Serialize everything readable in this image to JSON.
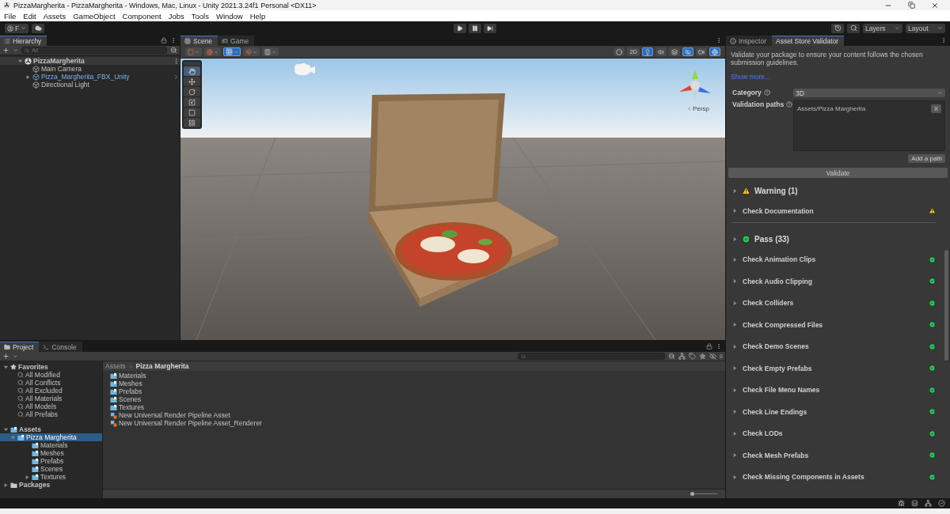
{
  "window": {
    "title": "PizzaMargherita - PizzaMargherita - Windows, Mac, Linux - Unity 2021.3.24f1 Personal <DX11>"
  },
  "menu": [
    "File",
    "Edit",
    "Assets",
    "GameObject",
    "Component",
    "Jobs",
    "Tools",
    "Window",
    "Help"
  ],
  "toolbar": {
    "account": "F",
    "layers": "Layers",
    "layout": "Layout"
  },
  "hierarchy": {
    "title": "Hierarchy",
    "search": {
      "placeholder": "All"
    },
    "items": [
      {
        "label": "PizzaMargherita",
        "kind": "scene",
        "expanded": true,
        "children": [
          {
            "label": "Main Camera",
            "kind": "object"
          },
          {
            "label": "Pizza_Margherita_FBX_Unity",
            "kind": "prefab",
            "expanded": false
          },
          {
            "label": "Directional Light",
            "kind": "object"
          }
        ]
      }
    ]
  },
  "scene_view": {
    "tabs": [
      {
        "label": "Scene",
        "kind": "scene",
        "selected": true
      },
      {
        "label": "Game",
        "kind": "game",
        "selected": false
      }
    ],
    "left_tools": [
      {
        "kind": "pivot",
        "on": false
      },
      {
        "kind": "global",
        "on": false
      },
      {
        "kind": "grid",
        "on": true
      },
      {
        "kind": "snap",
        "on": false
      },
      {
        "kind": "increment",
        "on": false
      }
    ],
    "right_tools": [
      {
        "kind": "shading",
        "on": false
      },
      {
        "kind": "text",
        "label": "2D",
        "on": false
      },
      {
        "kind": "light",
        "on": true
      },
      {
        "kind": "audio",
        "on": false
      },
      {
        "kind": "effects",
        "on": false
      },
      {
        "kind": "visibility",
        "on": true
      },
      {
        "kind": "camera",
        "on": false
      },
      {
        "kind": "gizmos",
        "on": true
      }
    ],
    "tools": [
      {
        "kind": "hand",
        "selected": true
      },
      {
        "kind": "move",
        "selected": false
      },
      {
        "kind": "rotate",
        "selected": false
      },
      {
        "kind": "scale",
        "selected": false
      },
      {
        "kind": "rect",
        "selected": false
      },
      {
        "kind": "transform",
        "selected": false
      }
    ],
    "projection": "Persp"
  },
  "inspector": {
    "tabs": [
      {
        "label": "Inspector",
        "selected": false
      },
      {
        "label": "Asset Store Validator",
        "selected": true
      }
    ],
    "description": "Validate your package to ensure your content follows the chosen submission guidelines.",
    "show_more": "Show more...",
    "category": {
      "label": "Category",
      "value": "3D"
    },
    "validation_paths": {
      "label": "Validation paths",
      "paths": [
        {
          "path": "Assets/Pizza Margherita",
          "remove": "X"
        }
      ],
      "add": "Add a path"
    },
    "validate": "Validate",
    "groups": [
      {
        "title": "Warning (1)",
        "kind": "warning",
        "checks": [
          "Check Documentation"
        ]
      },
      {
        "title": "Pass (33)",
        "kind": "pass",
        "checks": [
          "Check Animation Clips",
          "Check Audio Clipping",
          "Check Colliders",
          "Check Compressed Files",
          "Check Demo Scenes",
          "Check Empty Prefabs",
          "Check File Menu Names",
          "Check Line Endings",
          "Check LODs",
          "Check Mesh Prefabs",
          "Check Missing Components in Assets"
        ]
      }
    ]
  },
  "project": {
    "tabs": [
      {
        "label": "Project",
        "kind": "project",
        "selected": true
      },
      {
        "label": "Console",
        "kind": "console",
        "selected": false
      }
    ],
    "hidden_count": "8",
    "tree": [
      {
        "label": "Favorites",
        "kind": "favorites",
        "expanded": true,
        "selected": false,
        "children": [
          {
            "label": "All Modified",
            "kind": "search",
            "selected": false
          },
          {
            "label": "All Conflicts",
            "kind": "search",
            "selected": false
          },
          {
            "label": "All Excluded",
            "kind": "search",
            "selected": false
          },
          {
            "label": "All Materials",
            "kind": "search",
            "selected": false
          },
          {
            "label": "All Models",
            "kind": "search",
            "selected": false
          },
          {
            "label": "All Prefabs",
            "kind": "search",
            "selected": false
          }
        ]
      },
      {
        "label": "Assets",
        "kind": "assets",
        "expanded": true,
        "selected": false,
        "children": [
          {
            "label": "Pizza Margherita",
            "kind": "assets",
            "expanded": true,
            "selected": true,
            "children": [
              {
                "label": "Materials",
                "kind": "assets",
                "selected": false
              },
              {
                "label": "Meshes",
                "kind": "assets",
                "selected": false
              },
              {
                "label": "Prefabs",
                "kind": "assets",
                "selected": false
              },
              {
                "label": "Scenes",
                "kind": "assets",
                "selected": false
              },
              {
                "label": "Textures",
                "kind": "assets",
                "expanded": false,
                "selected": false
              }
            ]
          }
        ]
      },
      {
        "label": "Packages",
        "kind": "packages",
        "expanded": false,
        "selected": false
      }
    ],
    "breadcrumb": [
      "Assets",
      "Pizza Margherita"
    ],
    "files": [
      {
        "label": "Materials",
        "kind": "folder"
      },
      {
        "label": "Meshes",
        "kind": "folder"
      },
      {
        "label": "Prefabs",
        "kind": "folder"
      },
      {
        "label": "Scenes",
        "kind": "folder"
      },
      {
        "label": "Textures",
        "kind": "folder"
      },
      {
        "label": "New Universal Render Pipeline Asset",
        "kind": "pipeline"
      },
      {
        "label": "New Universal Render Pipeline Asset_Renderer",
        "kind": "pipeline"
      }
    ],
    "zoom_slider": {
      "level": 0
    }
  }
}
